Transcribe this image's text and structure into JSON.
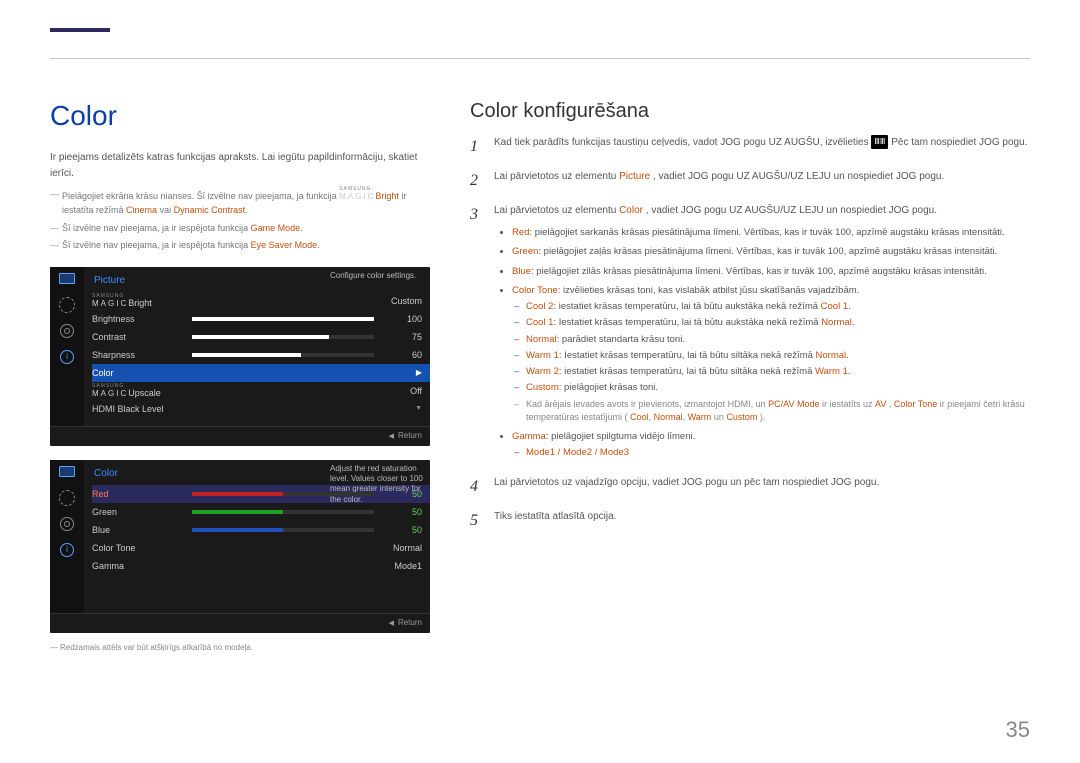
{
  "page": {
    "number": "35"
  },
  "left": {
    "heading": "Color",
    "intro": "Ir pieejams detalizēts katras funkcijas apraksts. Lai iegūtu papildinformāciju, skatiet ierīci.",
    "note1_pre": "Pielāgojiet ekrāna krāsu nianses. Šī izvēlne nav pieejama, ja funkcija ",
    "note1_magic": "Bright",
    "note1_post": " ir iestatīta režīmā ",
    "note1_hl1": "Cinema",
    "note1_mid": " vai ",
    "note1_hl2": "Dynamic Contrast",
    "note2_pre": "Šī izvēlne nav pieejama, ja ir iespējota funkcija ",
    "note2_hl": "Game Mode",
    "note3_pre": "Šī izvēlne nav pieejama, ja ir iespējota funkcija ",
    "note3_hl": "Eye Saver Mode",
    "osd1": {
      "title": "Picture",
      "desc": "Configure color settings.",
      "rows": {
        "magicbright_label": "Bright",
        "magicbright_val": "Custom",
        "brightness_label": "Brightness",
        "brightness_val": "100",
        "contrast_label": "Contrast",
        "contrast_val": "75",
        "sharpness_label": "Sharpness",
        "sharpness_val": "60",
        "color_label": "Color",
        "upscale_label": "Upscale",
        "upscale_val": "Off",
        "hdmi_label": "HDMI Black Level"
      },
      "return": "Return"
    },
    "osd2": {
      "title": "Color",
      "desc": "Adjust the red saturation level. Values closer to 100 mean greater intensity for the color.",
      "rows": {
        "red_label": "Red",
        "red_val": "50",
        "green_label": "Green",
        "green_val": "50",
        "blue_label": "Blue",
        "blue_val": "50",
        "colortone_label": "Color Tone",
        "colortone_val": "Normal",
        "gamma_label": "Gamma",
        "gamma_val": "Mode1"
      },
      "return": "Return"
    },
    "footnote": "Redzamais attēls var būt atšķirīgs atkarībā no modeļa."
  },
  "right": {
    "heading": "Color konfigurēšana",
    "steps": {
      "s1_pre": "Kad tiek parādīts funkcijas taustiņu ceļvedis, vadot JOG pogu UZ AUGŠU, izvēlieties ",
      "s1_post": " Pēc tam nospiediet JOG pogu.",
      "s2_pre": "Lai pārvietotos uz elementu ",
      "s2_hl": "Picture",
      "s2_post": ", vadiet JOG pogu UZ AUGŠU/UZ LEJU un nospiediet JOG pogu.",
      "s3_pre": "Lai pārvietotos uz elementu ",
      "s3_hl": "Color",
      "s3_post": ", vadiet JOG pogu UZ AUGŠU/UZ LEJU un nospiediet JOG pogu.",
      "s4": "Lai pārvietotos uz vajadzīgo opciju, vadiet JOG pogu un pēc tam nospiediet JOG pogu.",
      "s5": "Tiks iestatīta atlasītā opcija."
    },
    "bullets": {
      "red_hl": "Red",
      "red_txt": ": pielāgojiet sarkanās krāsas piesātinājuma līmeni. Vērtības, kas ir tuvāk 100, apzīmē augstāku krāsas intensitāti.",
      "green_hl": "Green",
      "green_txt": ": pielāgojiet zaļās krāsas piesātinājuma līmeni. Vērtības, kas ir tuvāk 100, apzīmē augstāku krāsas intensitāti.",
      "blue_hl": "Blue",
      "blue_txt": ": pielāgojiet zilās krāsas piesātinājuma līmeni. Vērtības, kas ir tuvāk 100, apzīmē augstāku krāsas intensitāti.",
      "ct_hl": "Color Tone",
      "ct_txt": ": izvēlieties krāsas toni, kas vislabāk atbilst jūsu skatīšanās vajadzībām.",
      "cool2_hl": "Cool 2",
      "cool2_txt": ": iestatiet krāsas temperatūru, lai tā būtu aukstāka nekā režīmā ",
      "cool2_end": "Cool 1",
      "cool1_hl": "Cool 1",
      "cool1_txt": ": Iestatiet krāsas temperatūru, lai tā būtu aukstāka nekā režīmā ",
      "cool1_end": "Normal",
      "normal_hl": "Normal",
      "normal_txt": ": parādiet standarta krāsu toni.",
      "warm1_hl": "Warm 1",
      "warm1_txt": ": Iestatiet krāsas temperatūru, lai tā būtu siltāka nekā režīmā ",
      "warm1_end": "Normal",
      "warm2_hl": "Warm 2",
      "warm2_txt": ": iestatiet krāsas temperatūru, lai tā būtu siltāka nekā režīmā ",
      "warm2_end": "Warm 1",
      "custom_hl": "Custom",
      "custom_txt": ": pielāgojiet krāsas toni.",
      "hdmi_note_pre": "Kad ārējais ievades avots ir pievienots, izmantojot HDMI, un ",
      "hdmi_note_hl1": "PC/AV Mode",
      "hdmi_note_mid1": " ir iestatīts uz ",
      "hdmi_note_hl2": "AV",
      "hdmi_note_mid2": ", ",
      "hdmi_note_hl3": "Color Tone",
      "hdmi_note_mid3": " ir pieejami četri krāsu temperatūras iestatījumi (",
      "hdmi_note_c": "Cool",
      "hdmi_note_n": "Normal",
      "hdmi_note_w": "Warm",
      "hdmi_note_un": " un ",
      "hdmi_note_cu": "Custom",
      "hdmi_note_end": ").",
      "gamma_hl": "Gamma",
      "gamma_txt": ": pielāgojiet spilgtuma vidējo līmeni.",
      "modes": "Mode1 / Mode2 / Mode3"
    }
  }
}
